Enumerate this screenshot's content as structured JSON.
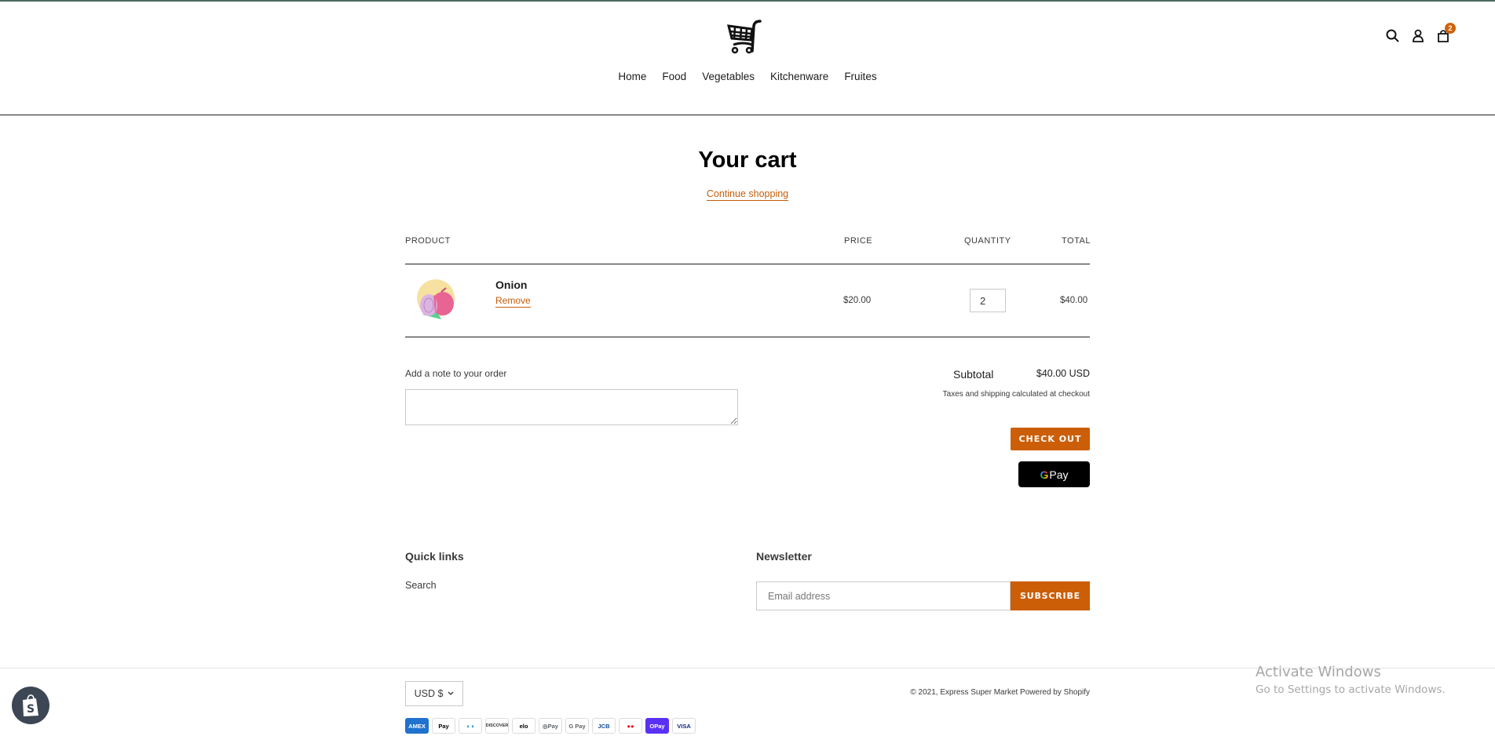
{
  "header": {
    "logo_alt": "shopping-cart-logo",
    "nav": [
      "Home",
      "Food",
      "Vegetables",
      "Kitchenware",
      "Fruites"
    ],
    "cart_count": "2",
    "icons": [
      "search-icon",
      "account-icon",
      "cart-icon"
    ]
  },
  "cart": {
    "title": "Your cart",
    "continue_shopping": "Continue shopping",
    "columns": {
      "product": "PRODUCT",
      "price": "PRICE",
      "quantity": "QUANTITY",
      "total": "TOTAL"
    },
    "items": [
      {
        "name": "Onion",
        "remove_label": "Remove",
        "price": "$20.00",
        "quantity": "2",
        "total": "$40.00"
      }
    ],
    "note_label": "Add a note to your order",
    "note_value": "",
    "subtotal_label": "Subtotal",
    "subtotal_value": "$40.00 USD",
    "tax_note": "Taxes and shipping calculated at checkout",
    "checkout_label": "CHECK OUT",
    "gpay_label": "Pay",
    "gpay_g": "G"
  },
  "footer": {
    "quick_links_title": "Quick links",
    "quick_links": [
      "Search"
    ],
    "newsletter_title": "Newsletter",
    "email_placeholder": "Email address",
    "subscribe_label": "SUBSCRIBE",
    "currency": "USD $",
    "copyright": "© 2021, Express Super Market Powered by Shopify",
    "payment_methods": [
      {
        "label": "AMEX",
        "bg": "#1f72cd",
        "fg": "#ffffff"
      },
      {
        "label": " Pay",
        "bg": "#ffffff",
        "fg": "#000000"
      },
      {
        "label": "◐◑",
        "bg": "#ffffff",
        "fg": "#0079be"
      },
      {
        "label": "DISCOVER",
        "bg": "#ffffff",
        "fg": "#333333"
      },
      {
        "label": "elo",
        "bg": "#ffffff",
        "fg": "#000000"
      },
      {
        "label": "◎Pay",
        "bg": "#ffffff",
        "fg": "#5f6368"
      },
      {
        "label": "G Pay",
        "bg": "#ffffff",
        "fg": "#5f6368"
      },
      {
        "label": "JCB",
        "bg": "#ffffff",
        "fg": "#0e4c96"
      },
      {
        "label": "●●",
        "bg": "#ffffff",
        "fg": "#eb001b"
      },
      {
        "label": "OPay",
        "bg": "#5a31f4",
        "fg": "#ffffff"
      },
      {
        "label": "VISA",
        "bg": "#ffffff",
        "fg": "#142688"
      }
    ]
  },
  "overlay": {
    "activate_title": "Activate Windows",
    "activate_sub": "Go to Settings to activate Windows."
  },
  "colors": {
    "accent": "#cc5e08",
    "link": "#c55d0a",
    "text": "#3a3a3a"
  }
}
